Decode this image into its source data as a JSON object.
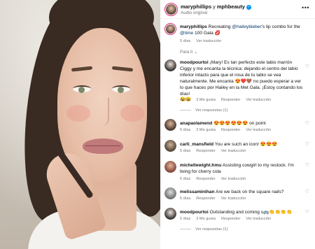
{
  "header": {
    "username": "maryphillips",
    "collab_joiner": "y",
    "collab_user": "mphbeauty",
    "audio": "Audio original",
    "more": "•••"
  },
  "caption": {
    "username": "maryphillips",
    "text_before": " Recreating ",
    "mention1": "@haileybieber",
    "text_mid": "'s lip combo for the ",
    "mention2": "@time",
    "text_after": " 100 Gala 💋",
    "time": "5 días",
    "translate": "Ver traducción"
  },
  "sort_label": "Para ti ⌄",
  "comments": [
    {
      "username": "moodpourtoi",
      "text": "¡Mary! Es tan perfecto este labio marrón Ciggy y me encanta la técnica: dejando el centro del labio inferior intacto para que el rosa de tu labio se vea naturalmente. Me encanta 😍❤️🤎 no puedo esperar a ver lo que haces por Hailey en la Met Gala. ¡Estoy contando los días!",
      "extra": "😮😮",
      "time": "4 días",
      "likes": "3 Me gusta",
      "reply": "Responder",
      "translate": "Ver traducción",
      "replies": "Ver respuestas (1)"
    },
    {
      "username": "anapaolamend",
      "text": "😍😍😍😍😍😍 on point",
      "time": "5 días",
      "likes": "3 Me gusta",
      "reply": "Responder",
      "translate": "Ver traducción"
    },
    {
      "username": "carli_mansfield",
      "text": "You are such an icon! 😍😍😍",
      "time": "5 días",
      "likes": "",
      "reply": "Responder",
      "translate": "Ver traducción"
    },
    {
      "username": "michellewight.hmu",
      "text": "Assisting cowgirl to my restock. I'm living for cherry cola",
      "time": "5 días",
      "likes": "",
      "reply": "Responder",
      "translate": "Ver traducción"
    },
    {
      "username": "melissaminihan",
      "text": "Are we back on the square nails?",
      "time": "5 días",
      "likes": "",
      "reply": "Responder",
      "translate": "Ver traducción"
    },
    {
      "username": "moodpourtoi",
      "text": "Outstanding and coming s🚌👏👏👏👏",
      "time": "5 días",
      "likes": "3 Me gusta",
      "reply": "Responder",
      "translate": "Ver traducción",
      "replies": "Ver respuestas (1)"
    }
  ],
  "colors": {
    "link": "#00376b",
    "muted": "#737373",
    "verified": "#0095f6"
  }
}
